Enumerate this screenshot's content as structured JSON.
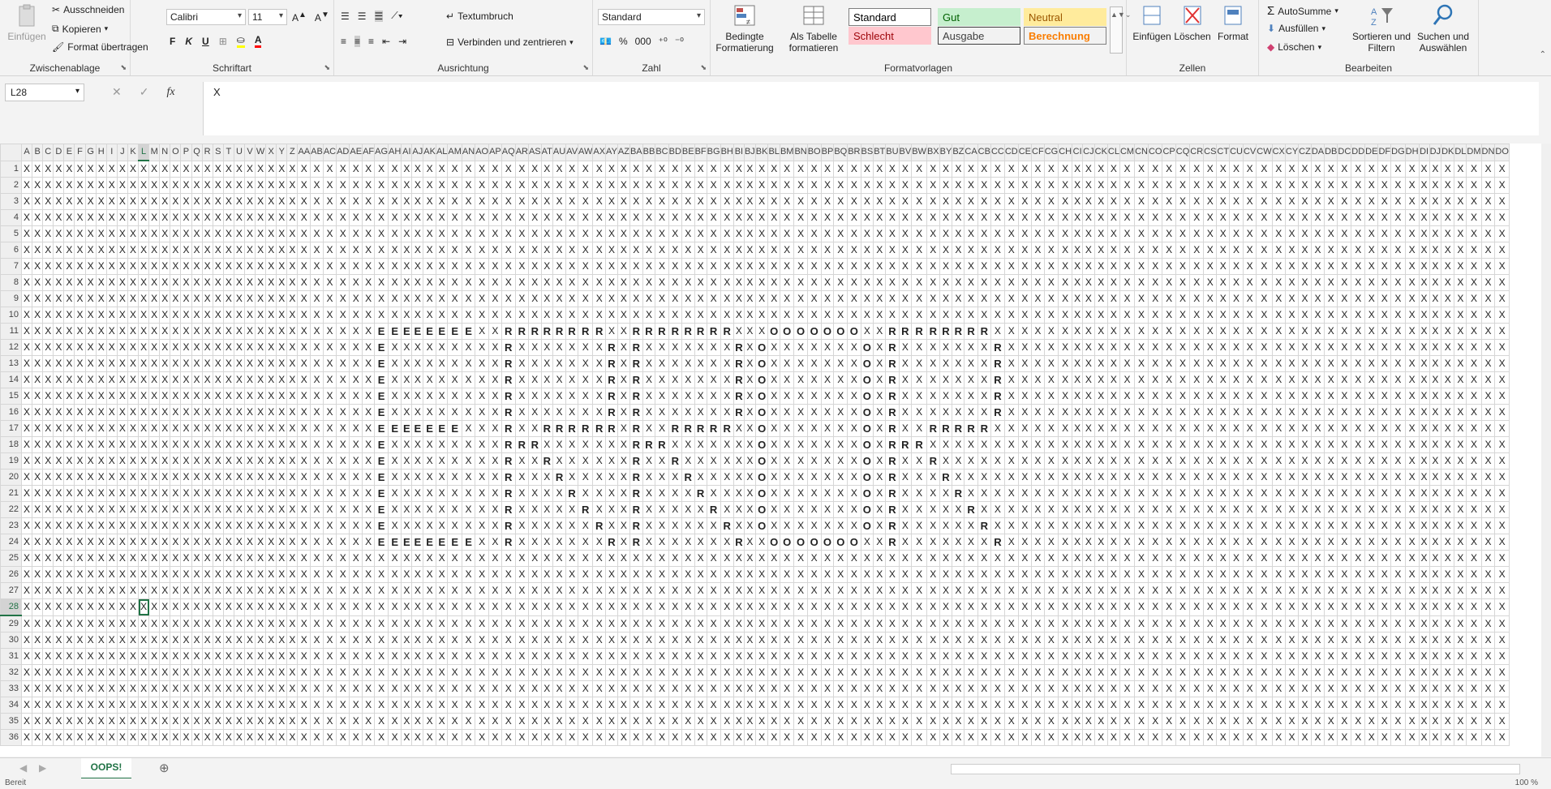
{
  "ribbon": {
    "clipboard": {
      "title": "Zwischenablage",
      "paste": "Einfügen",
      "cut": "Ausschneiden",
      "copy": "Kopieren",
      "format_painter": "Format übertragen"
    },
    "font": {
      "title": "Schriftart",
      "font_name": "Calibri",
      "font_size": "11"
    },
    "alignment": {
      "title": "Ausrichtung",
      "wrap": "Textumbruch",
      "merge": "Verbinden und zentrieren"
    },
    "number": {
      "title": "Zahl",
      "format": "Standard"
    },
    "styles": {
      "title": "Formatvorlagen",
      "conditional": "Bedingte Formatierung",
      "as_table": "Als Tabelle formatieren",
      "items": [
        {
          "label": "Standard",
          "bg": "#ffffff",
          "fg": "#000000",
          "border": "#7f7f7f"
        },
        {
          "label": "Gut",
          "bg": "#c6efce",
          "fg": "#006100",
          "border": "#c6efce"
        },
        {
          "label": "Neutral",
          "bg": "#ffeb9c",
          "fg": "#9c5700",
          "border": "#ffeb9c"
        },
        {
          "label": "Schlecht",
          "bg": "#ffc7ce",
          "fg": "#9c0006",
          "border": "#ffc7ce"
        },
        {
          "label": "Ausgabe",
          "bg": "#f2f2f2",
          "fg": "#3f3f3f",
          "border": "#3f3f3f"
        },
        {
          "label": "Berechnung",
          "bg": "#f2f2f2",
          "fg": "#fa7d00",
          "border": "#7f7f7f"
        }
      ]
    },
    "cells": {
      "title": "Zellen",
      "insert": "Einfügen",
      "delete": "Löschen",
      "format": "Format"
    },
    "editing": {
      "title": "Bearbeiten",
      "autosum": "AutoSumme",
      "fill": "Ausfüllen",
      "clear": "Löschen",
      "sort": "Sortieren und Filtern",
      "find": "Suchen und Auswählen"
    }
  },
  "formula_bar": {
    "name_box": "L28",
    "content": "X"
  },
  "grid": {
    "columns": [
      "A",
      "B",
      "C",
      "D",
      "E",
      "F",
      "G",
      "H",
      "I",
      "J",
      "K",
      "L",
      "M",
      "N",
      "O",
      "P",
      "Q",
      "R",
      "S",
      "T",
      "U",
      "V",
      "W",
      "X",
      "Y",
      "Z",
      "AA",
      "AB",
      "AC",
      "AD",
      "AE",
      "AF",
      "AG",
      "AH",
      "AI",
      "AJ",
      "AK",
      "AL",
      "AM",
      "AN",
      "AO",
      "AP",
      "AQ",
      "AR",
      "AS",
      "AT",
      "AU",
      "AV",
      "AW",
      "AX",
      "AY",
      "AZ",
      "BA",
      "BB",
      "BC",
      "BD",
      "BE",
      "BF",
      "BG",
      "BH",
      "BI",
      "BJ",
      "BK",
      "BL",
      "BM",
      "BN",
      "BO",
      "BP",
      "BQ",
      "BR",
      "BS",
      "BT",
      "BU",
      "BV",
      "BW",
      "BX",
      "BY",
      "BZ",
      "CA",
      "CB",
      "CC",
      "CD",
      "CE",
      "CF",
      "CG",
      "CH",
      "CI",
      "CJ",
      "CK",
      "CL",
      "CM",
      "CN",
      "CO",
      "CP",
      "CQ",
      "CR",
      "CS",
      "CT",
      "CU",
      "CV",
      "CW",
      "CX",
      "CY",
      "CZ",
      "DA",
      "DB",
      "DC",
      "DD",
      "DE",
      "DF",
      "DG",
      "DH",
      "DI",
      "DJ",
      "DK",
      "DL",
      "DM",
      "DN",
      "DO"
    ],
    "rows": [
      1,
      2,
      3,
      4,
      5,
      6,
      7,
      8,
      9,
      10,
      11,
      12,
      13,
      14,
      15,
      16,
      17,
      18,
      19,
      20,
      21,
      22,
      23,
      24,
      25,
      26,
      27,
      28,
      29,
      30,
      31,
      32,
      33,
      34,
      35,
      36
    ],
    "default_value": "X",
    "selected_cell": "L28",
    "word_rows": {
      "11": "xxxxxxxxxxxxxxxxxxxxxxxxxxxxxxxxEEEEEEEExxRRRRRRRRxxRRRRRRRRxxxOOOOOOOxxRRRRRRRRx",
      "12": "xxxxxxxxxxxxxxxxxxxxxxxxxxxxxxxxExxxxxxxxxRxxxxxxxRxRxxxxxxxRxOxxxxxxxOxRxxxxxxxR",
      "13": "xxxxxxxxxxxxxxxxxxxxxxxxxxxxxxxxExxxxxxxxxRxxxxxxxRxRxxxxxxxRxOxxxxxxxOxRxxxxxxxR",
      "14": "xxxxxxxxxxxxxxxxxxxxxxxxxxxxxxxxExxxxxxxxxRxxxxxxxRxRxxxxxxxRxOxxxxxxxOxRxxxxxxxR",
      "15": "xxxxxxxxxxxxxxxxxxxxxxxxxxxxxxxxExxxxxxxxxRxxxxxxxRxRxxxxxxxRxOxxxxxxxOxRxxxxxxxR",
      "16": "xxxxxxxxxxxxxxxxxxxxxxxxxxxxxxxxExxxxxxxxxRxxxxxxxRxRxxxxxxxRxOxxxxxxxOxRxxxxxxxR",
      "17": "xxxxxxxxxxxxxxxxxxxxxxxxxxxxxxxxEEEEEEExxxRxxRRRRRRxRxxRRRRRxxOxxxxxxxOxRxxRRRRRx",
      "18": "xxxxxxxxxxxxxxxxxxxxxxxxxxxxxxxxExxxxxxxxxRRRxxxxxxxRRRxxxxxxxOxxxxxxxOxRRRxxxxxx",
      "19": "xxxxxxxxxxxxxxxxxxxxxxxxxxxxxxxxExxxxxxxxxRxxRxxxxxxRxxRxxxxxxOxxxxxxxOxRxxRxxxxx",
      "20": "xxxxxxxxxxxxxxxxxxxxxxxxxxxxxxxxExxxxxxxxxRxxxRxxxxxRxxxRxxxxxOxxxxxxxOxRxxxRxxxx",
      "21": "xxxxxxxxxxxxxxxxxxxxxxxxxxxxxxxxExxxxxxxxxRxxxxRxxxxRxxxxRxxxxOxxxxxxxOxRxxxxRxxx",
      "22": "xxxxxxxxxxxxxxxxxxxxxxxxxxxxxxxxExxxxxxxxxRxxxxxRxxxRxxxxxRxxxOxxxxxxxOxRxxxxxRxx",
      "23": "xxxxxxxxxxxxxxxxxxxxxxxxxxxxxxxxExxxxxxxxxRxxxxxxRxxRxxxxxxRxxOxxxxxxxOxRxxxxxxRx",
      "24": "xxxxxxxxxxxxxxxxxxxxxxxxxxxxxxxxEEEEEEEExxRxxxxxxxRxRxxxxxxxRxxOOOOOOOxxRxxxxxxxR"
    }
  },
  "sheet_tabs": {
    "active": "OOPS!"
  },
  "status": {
    "ready": "Bereit",
    "zoom": "100 %"
  }
}
